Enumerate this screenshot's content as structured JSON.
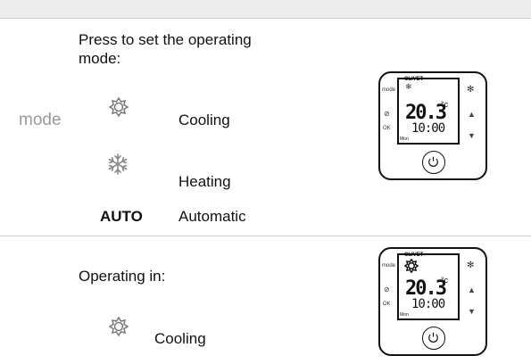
{
  "section1": {
    "instruction": "Press to set the operating mode:",
    "instruction_line1": "Press to set the operating",
    "instruction_line2": "mode:",
    "mode_key": "mode",
    "options": [
      {
        "icon": "sun-icon",
        "label": "Cooling"
      },
      {
        "icon": "snowflake-icon",
        "label": "Heating"
      },
      {
        "key": "AUTO",
        "label": "Automatic"
      }
    ]
  },
  "section2": {
    "instruction": "Operating in:",
    "option": {
      "icon": "sun-icon",
      "label": "Cooling"
    }
  },
  "device": {
    "brand": "CLIVET",
    "temperature": "20.3",
    "unit": "°c",
    "time": "10:00",
    "day": "Mon",
    "left_buttons": [
      "mode",
      "OK"
    ]
  }
}
